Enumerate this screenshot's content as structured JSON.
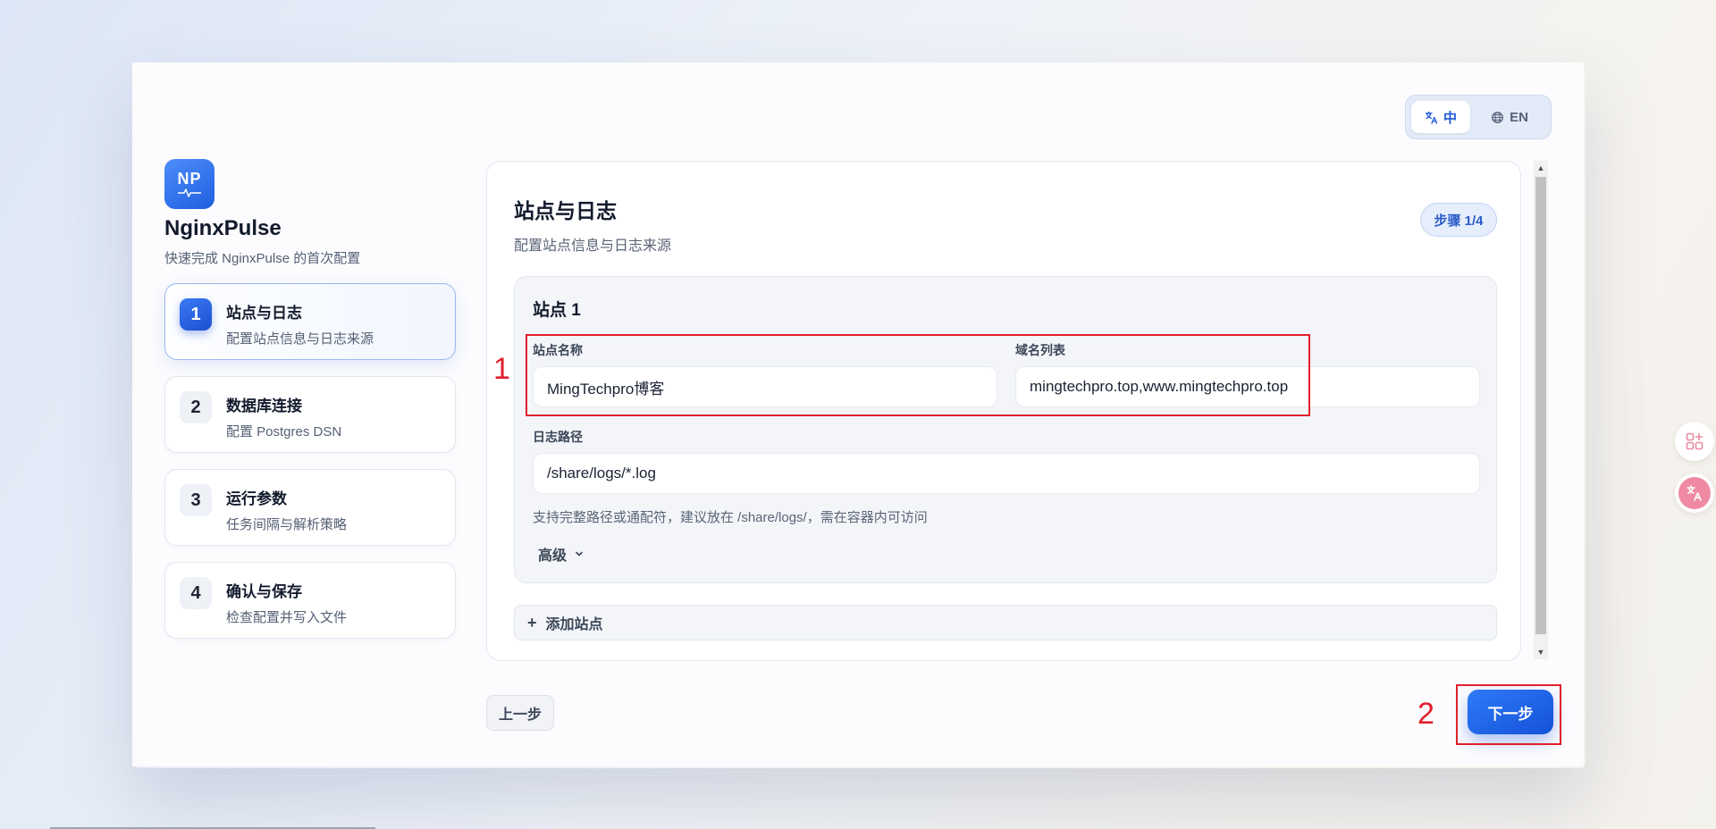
{
  "language_toggle": {
    "zh_label": "中",
    "en_label": "EN"
  },
  "sidebar": {
    "logo_text": "NP",
    "app_name": "NginxPulse",
    "app_subtitle": "快速完成 NginxPulse 的首次配置",
    "steps": [
      {
        "number": "1",
        "title": "站点与日志",
        "desc": "配置站点信息与日志来源",
        "active": true
      },
      {
        "number": "2",
        "title": "数据库连接",
        "desc": "配置 Postgres DSN",
        "active": false
      },
      {
        "number": "3",
        "title": "运行参数",
        "desc": "任务间隔与解析策略",
        "active": false
      },
      {
        "number": "4",
        "title": "确认与保存",
        "desc": "检查配置并写入文件",
        "active": false
      }
    ]
  },
  "main": {
    "title": "站点与日志",
    "subtitle": "配置站点信息与日志来源",
    "step_badge": "步骤 1/4",
    "site": {
      "title": "站点 1",
      "name_label": "站点名称",
      "name_value": "MingTechpro博客",
      "domains_label": "域名列表",
      "domains_value": "mingtechpro.top,www.mingtechpro.top",
      "log_path_label": "日志路径",
      "log_path_value": "/share/logs/*.log",
      "log_path_hint": "支持完整路径或通配符，建议放在 /share/logs/，需在容器内可访问",
      "advanced_label": "高级"
    },
    "add_site_label": "添加站点"
  },
  "footer": {
    "prev_label": "上一步",
    "next_label": "下一步"
  },
  "annotations": {
    "label_1": "1",
    "label_2": "2",
    "color": "#e0202c"
  },
  "colors": {
    "primary": "#1f5fe0",
    "active_step_border": "#9ab8ef"
  }
}
